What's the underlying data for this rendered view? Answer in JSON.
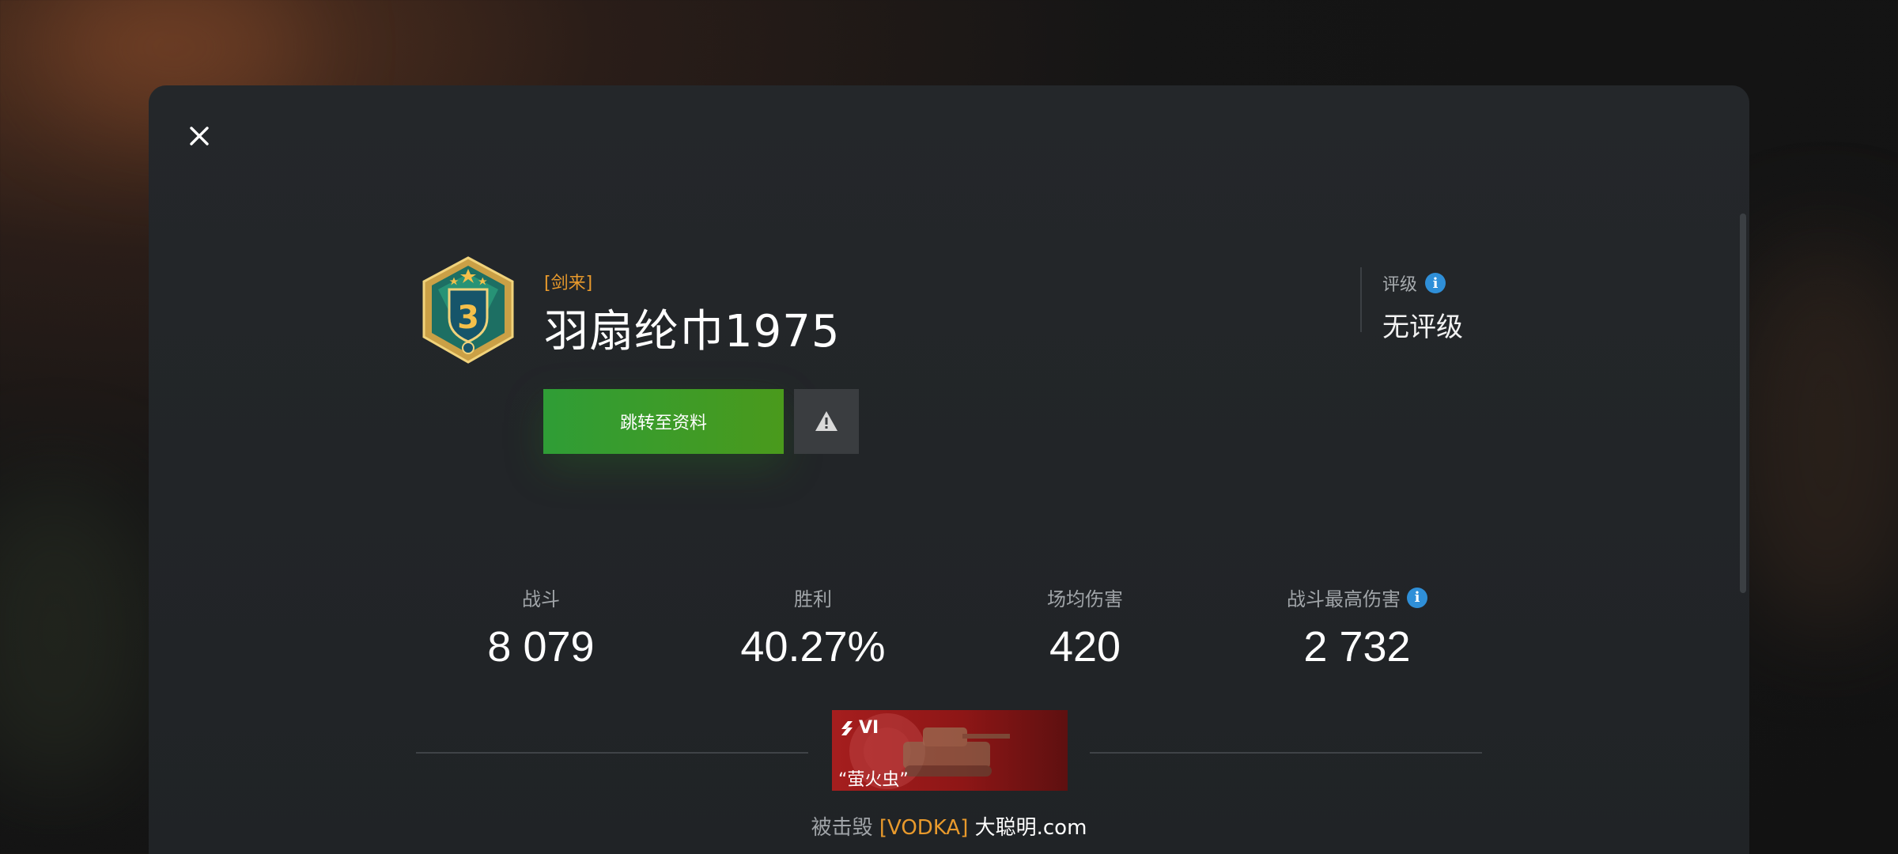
{
  "header": {
    "close_label": "×"
  },
  "player": {
    "clan_tag": "[剑来]",
    "name": "羽扇纶巾1975",
    "badge_level": "3"
  },
  "rating": {
    "label": "评级",
    "value": "无评级"
  },
  "actions": {
    "profile_button": "跳转至资料"
  },
  "stats": [
    {
      "label": "战斗",
      "value": "8 079"
    },
    {
      "label": "胜利",
      "value": "40.27%"
    },
    {
      "label": "场均伤害",
      "value": "420"
    },
    {
      "label": "战斗最高伤害",
      "value": "2 732"
    }
  ],
  "tank": {
    "tier": "VI",
    "name": "“萤火虫”"
  },
  "killed_by": {
    "label": "被击毁",
    "clan": "[VODKA]",
    "name": "大聪明.com"
  },
  "colors": {
    "accent_orange": "#e99a2c",
    "button_green": "#3d9b28",
    "info_blue": "#2f8fd8",
    "tank_red": "#a51e1e"
  },
  "icons": {
    "close": "close-icon",
    "warning": "warning-icon",
    "info": "info-icon",
    "badge": "rank-badge-icon",
    "tier": "tier-chevron-icon"
  }
}
